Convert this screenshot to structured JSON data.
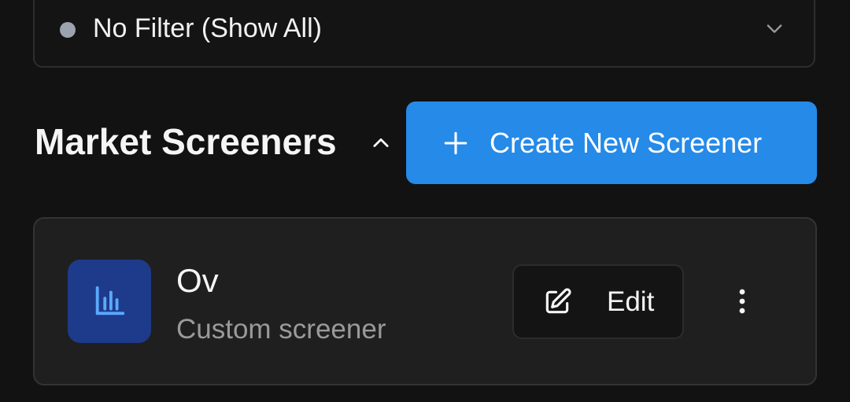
{
  "filter": {
    "label": "No Filter (Show All)",
    "dot_color": "#9ca3af",
    "icon": "chevron-down-icon"
  },
  "section": {
    "title": "Market Screeners",
    "toggle_icon": "chevron-up-icon",
    "create_button": {
      "label": "Create New Screener",
      "icon": "plus-icon",
      "color": "#258ae8"
    }
  },
  "screeners": [
    {
      "name": "Ov",
      "description": "Custom screener",
      "icon": "chart-bar-icon",
      "icon_bg": "#1e3a8a",
      "icon_color": "#5aa9ff",
      "edit_label": "Edit",
      "edit_icon": "edit-icon",
      "more_icon": "more-vertical-icon"
    }
  ]
}
